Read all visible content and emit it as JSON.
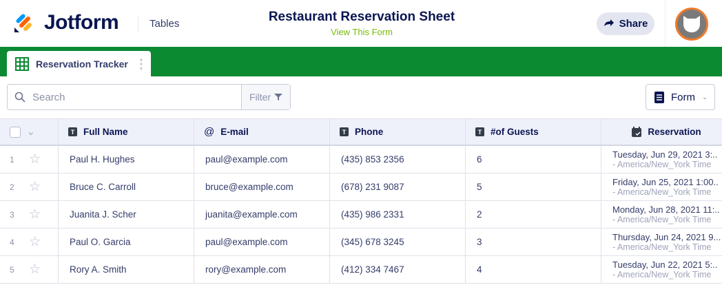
{
  "header": {
    "brand": "Jotform",
    "product": "Tables",
    "title": "Restaurant Reservation Sheet",
    "view_form": "View This Form",
    "share_label": "Share"
  },
  "tab": {
    "label": "Reservation Tracker"
  },
  "toolbar": {
    "search_placeholder": "Search",
    "filter_label": "Filter",
    "form_label": "Form"
  },
  "table": {
    "columns": [
      {
        "label": "Full Name",
        "icon": "text-icon"
      },
      {
        "label": "E-mail",
        "icon": "at-icon"
      },
      {
        "label": "Phone",
        "icon": "text-icon"
      },
      {
        "label": "#of Guests",
        "icon": "text-icon"
      },
      {
        "label": "Reservation",
        "icon": "calendar-icon"
      }
    ],
    "rows": [
      {
        "num": "1",
        "name": "Paul H. Hughes",
        "email": "paul@example.com",
        "phone": "(435) 853 2356",
        "guests": "6",
        "date": "Tuesday, Jun 29, 2021 3:..",
        "tz": "- America/New_York Time"
      },
      {
        "num": "2",
        "name": "Bruce C. Carroll",
        "email": "bruce@example.com",
        "phone": "(678) 231 9087",
        "guests": "5",
        "date": "Friday, Jun 25, 2021 1:00..",
        "tz": "- America/New_York Time"
      },
      {
        "num": "3",
        "name": "Juanita J. Scher",
        "email": "juanita@example.com",
        "phone": "(435) 986 2331",
        "guests": "2",
        "date": "Monday, Jun 28, 2021 11:..",
        "tz": "- America/New_York Time"
      },
      {
        "num": "4",
        "name": "Paul O. Garcia",
        "email": "paul@example.com",
        "phone": "(345) 678 3245",
        "guests": "3",
        "date": "Thursday, Jun 24, 2021 9...",
        "tz": "- America/New_York Time"
      },
      {
        "num": "5",
        "name": "Rory A. Smith",
        "email": "rory@example.com",
        "phone": "(412) 334 7467",
        "guests": "4",
        "date": "Tuesday, Jun 22, 2021 5:..",
        "tz": "- America/New_York Time"
      }
    ]
  },
  "colors": {
    "green": "#0c8a32",
    "navy": "#0a1551",
    "accent_orange": "#f07a2b"
  }
}
